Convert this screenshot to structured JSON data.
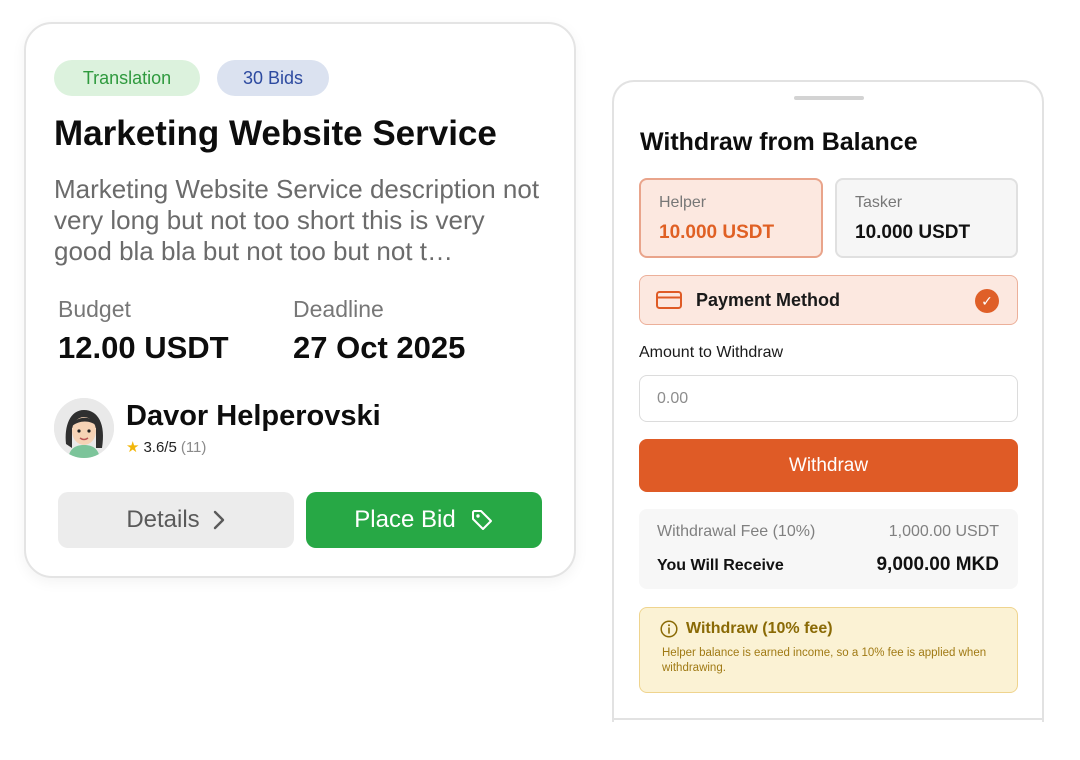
{
  "job_card": {
    "tags": [
      "Translation",
      "30 Bids"
    ],
    "title": "Marketing Website Service",
    "description": "Marketing Website Service description not very long but not too short this is very good bla bla but not too but not t…",
    "budget_label": "Budget",
    "budget_value": "12.00 USDT",
    "deadline_label": "Deadline",
    "deadline_value": "27 Oct 2025",
    "user_name": "Davor Helperovski",
    "rating": "3.6/5",
    "rating_count": "(11)",
    "details_label": "Details",
    "bid_label": "Place Bid",
    "colors": {
      "bid_button": "#27a845",
      "tag_green": "#2f9a3e",
      "tag_blue": "#2d4aa0"
    }
  },
  "withdraw_panel": {
    "title": "Withdraw from Balance",
    "balances": [
      {
        "label": "Helper",
        "amount": "10.000 USDT",
        "selected": true
      },
      {
        "label": "Tasker",
        "amount": "10.000 USDT",
        "selected": false
      }
    ],
    "payment_method_label": "Payment Method",
    "amount_label": "Amount to Withdraw",
    "amount_placeholder": "0.00",
    "withdraw_button": "Withdraw",
    "fee_label": "Withdrawal Fee (10%)",
    "fee_value": "1,000.00 USDT",
    "receive_label": "You Will Receive",
    "receive_value": "9,000.00 MKD",
    "notice_title": "Withdraw (10% fee)",
    "notice_text": "Helper balance is earned income, so a 10% fee is applied when withdrawing.",
    "colors": {
      "accent": "#df5b26",
      "notice_bg": "#fbf2d4",
      "notice_text": "#8a6a05"
    }
  }
}
